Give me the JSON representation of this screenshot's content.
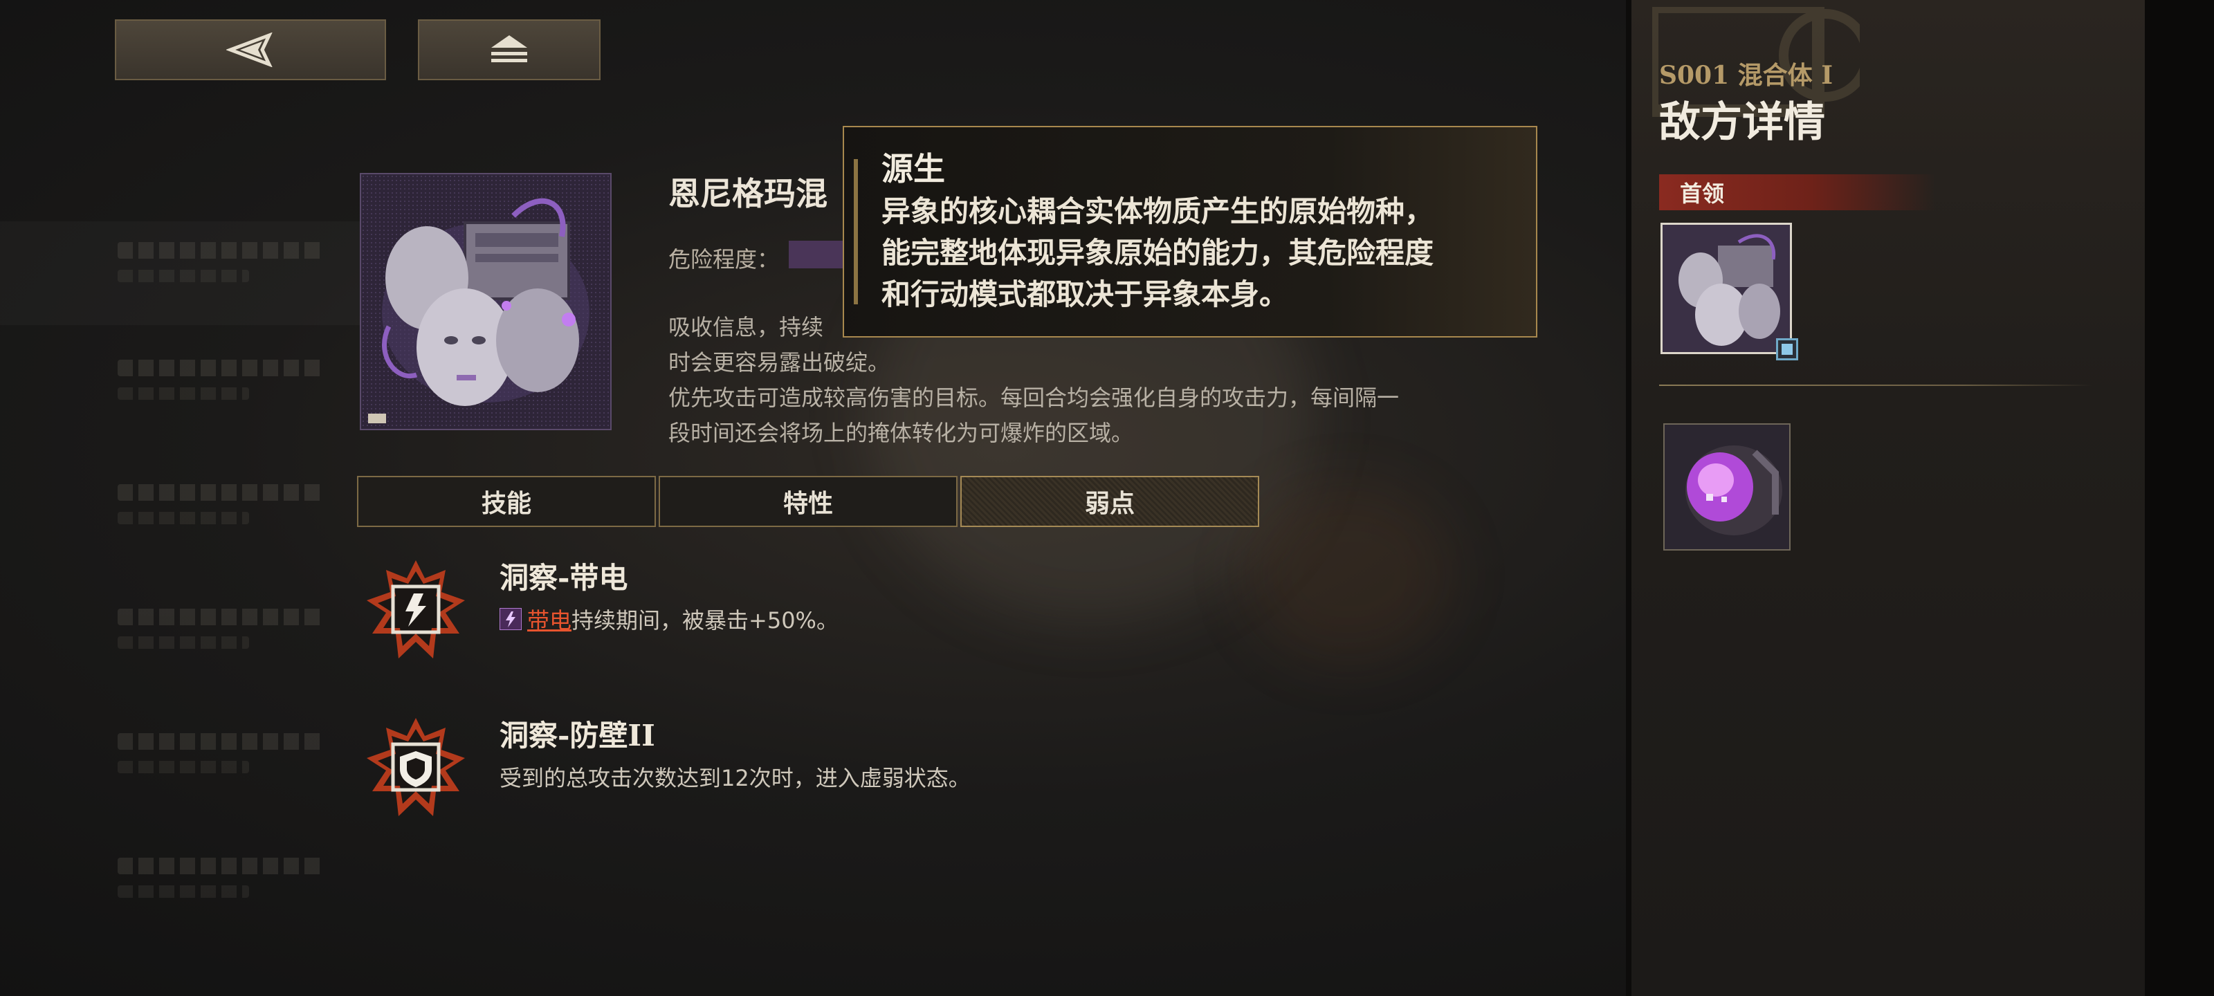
{
  "top_nav": {
    "back_icon": "back-arrow-icon",
    "home_icon": "home-stack-icon"
  },
  "enemy": {
    "name": "恩尼格玛混",
    "danger_label": "危险程度：",
    "description": [
      "吸收信息，持续",
      "时会更容易露出破绽。",
      "优先攻击可造成较高伤害的目标。每回合均会强化自身的攻击力，每间隔一",
      "段时间还会将场上的掩体转化为可爆炸的区域。"
    ]
  },
  "tooltip": {
    "title": "源生",
    "lines": [
      "异象的核心耦合实体物质产生的原始物种，",
      "能完整地体现异象原始的能力，其危险程度",
      "和行动模式都取决于异象本身。"
    ]
  },
  "tabs": [
    {
      "label": "技能",
      "active": false
    },
    {
      "label": "特性",
      "active": false
    },
    {
      "label": "弱点",
      "active": true
    }
  ],
  "weaknesses": [
    {
      "icon": "lightning-icon",
      "title": "洞察-带电",
      "buff_icon": "electric-buff-icon",
      "buff_name": "带电",
      "desc": "持续期间，被暴击+50%。"
    },
    {
      "icon": "shield-icon",
      "title": "洞察-防壁II",
      "desc": "受到的总攻击次数达到12次时，进入虚弱状态。"
    }
  ],
  "right_panel": {
    "subtitle": "S001 混合体 I",
    "title": "敌方详情",
    "boss_label": "首领"
  },
  "colors": {
    "accent_gold": "#a8884e",
    "boss_red": "#8a2a20",
    "weak_orange": "#e8542e",
    "purple": "#9b5fd0"
  }
}
